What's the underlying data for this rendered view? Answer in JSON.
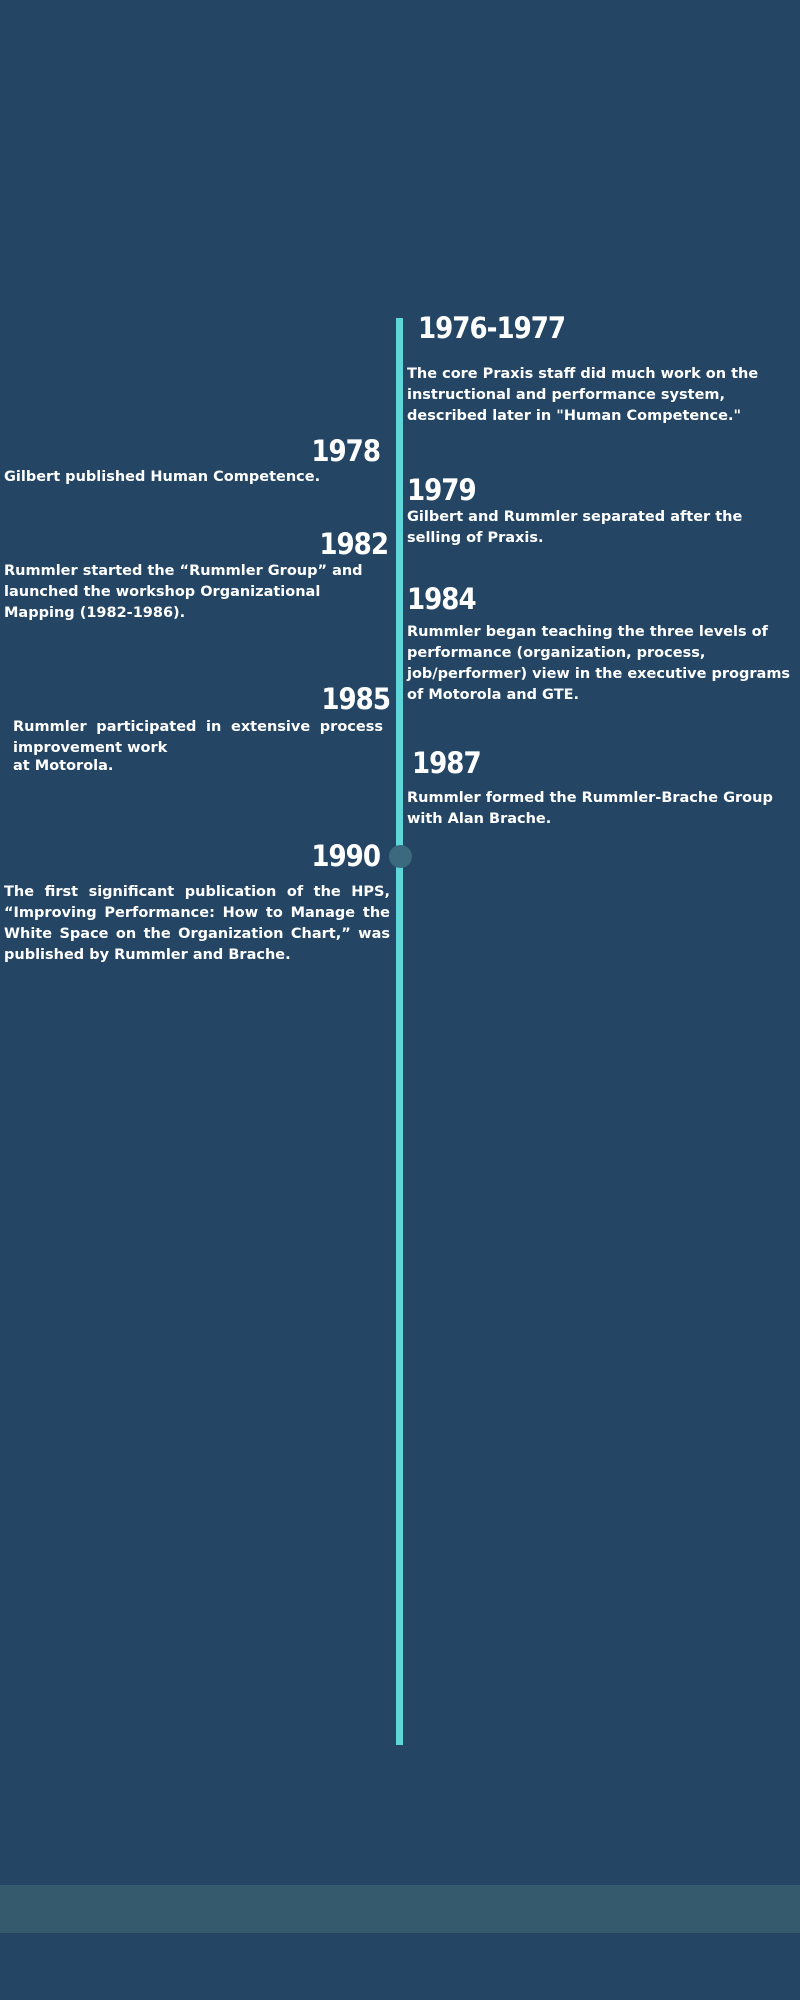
{
  "timeline": {
    "events": [
      {
        "year": "1976-1977",
        "text": "The core Praxis staff did much work on the instructional and performance system, described later in \"Human Competence.\""
      },
      {
        "year": "1978",
        "text": "Gilbert published Human Competence."
      },
      {
        "year": "1979",
        "text": "Gilbert and Rummler separated after the selling of Praxis."
      },
      {
        "year": "1982",
        "text": "Rummler started the “Rummler Group” and launched the workshop Organizational Mapping (1982-1986)."
      },
      {
        "year": "1984",
        "text": "Rummler began teaching the three levels of performance (organization, process, job/performer) view in the executive programs of Motorola and GTE."
      },
      {
        "year": "1985",
        "text_line1": "Rummler participated in extensive process improvement work",
        "text_line2": "at Motorola."
      },
      {
        "year": "1987",
        "text": "Rummler formed the Rummler-Brache Group with Alan Brache."
      },
      {
        "year": "1990",
        "text": "The first significant publication of the HPS, “Improving Performance: How to Manage the White Space on the Organization Chart,” was published by Rummler and Brache."
      }
    ]
  },
  "colors": {
    "background": "#244664",
    "timeline_line": "#5fd6d9",
    "timeline_dot": "#3b6a7e",
    "footer_band": "#365a6d",
    "text": "#ffffff"
  }
}
